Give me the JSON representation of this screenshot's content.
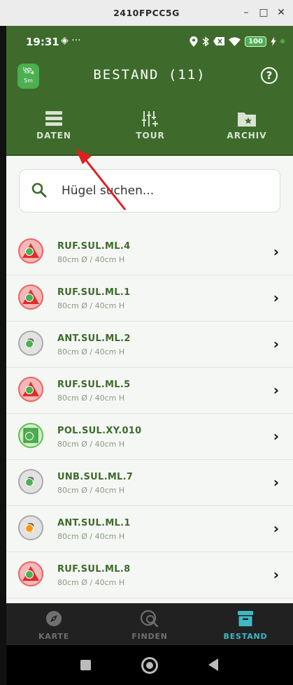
{
  "window": {
    "title": "2410FPCC5G",
    "minimize": "–",
    "maximize": "□",
    "close": "✕"
  },
  "status_bar": {
    "time": "19:31",
    "extra": "◈ ···",
    "battery": "100"
  },
  "app_bar": {
    "title": "BESTAND (11)",
    "gps_label": "5m",
    "help": "?"
  },
  "tabs": [
    {
      "label": "DATEN",
      "icon": "list-icon"
    },
    {
      "label": "TOUR",
      "icon": "tune-add-icon"
    },
    {
      "label": "ARCHIV",
      "icon": "folder-star-icon"
    }
  ],
  "search": {
    "placeholder": "Hügel suchen..."
  },
  "items": [
    {
      "name": "RUF.SUL.ML.4",
      "dims": "80cm Ø / 40cm H",
      "shape": "triangle",
      "status": "ok"
    },
    {
      "name": "RUF.SUL.ML.1",
      "dims": "80cm Ø / 40cm H",
      "shape": "triangle",
      "status": "ok"
    },
    {
      "name": "ANT.SUL.ML.2",
      "dims": "80cm Ø / 40cm H",
      "shape": "question",
      "status": "ok"
    },
    {
      "name": "RUF.SUL.ML.5",
      "dims": "80cm Ø / 40cm H",
      "shape": "triangle",
      "status": "ok"
    },
    {
      "name": "POL.SUL.XY.010",
      "dims": "80cm Ø / 40cm H",
      "shape": "square",
      "status": "ok"
    },
    {
      "name": "UNB.SUL.ML.7",
      "dims": "80cm Ø / 40cm H",
      "shape": "question",
      "status": "ok"
    },
    {
      "name": "ANT.SUL.ML.1",
      "dims": "80cm Ø / 40cm H",
      "shape": "question",
      "status": "warn"
    },
    {
      "name": "RUF.SUL.ML.8",
      "dims": "80cm Ø / 40cm H",
      "shape": "triangle",
      "status": "ok"
    }
  ],
  "bottom_nav": [
    {
      "label": "KARTE",
      "icon": "compass-icon"
    },
    {
      "label": "FINDEN",
      "icon": "search-location-icon"
    },
    {
      "label": "BESTAND",
      "icon": "archive-box-icon",
      "active": true
    }
  ],
  "colors": {
    "primary": "#3e6b2c",
    "accent": "#3fb8c4",
    "annotation": "#e02020"
  }
}
